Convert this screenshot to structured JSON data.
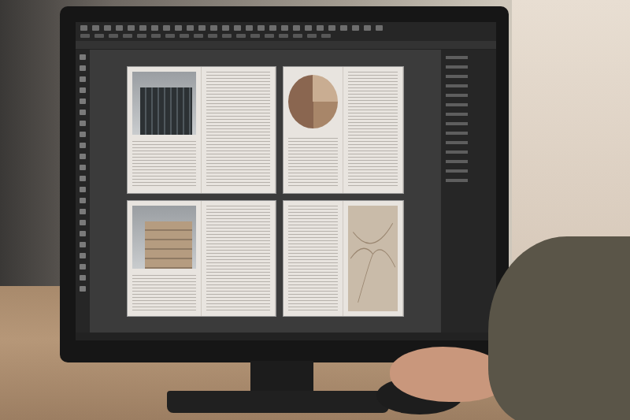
{
  "pages": [
    {
      "kind": "photo",
      "tone": "dark"
    },
    {
      "kind": "pie",
      "slices": [
        {
          "value": 25,
          "color": "#c9ad92"
        },
        {
          "value": 25,
          "color": "#a88669"
        },
        {
          "value": 50,
          "color": "#8a6650"
        }
      ]
    },
    {
      "kind": "photo",
      "tone": "light"
    },
    {
      "kind": "texture"
    }
  ]
}
